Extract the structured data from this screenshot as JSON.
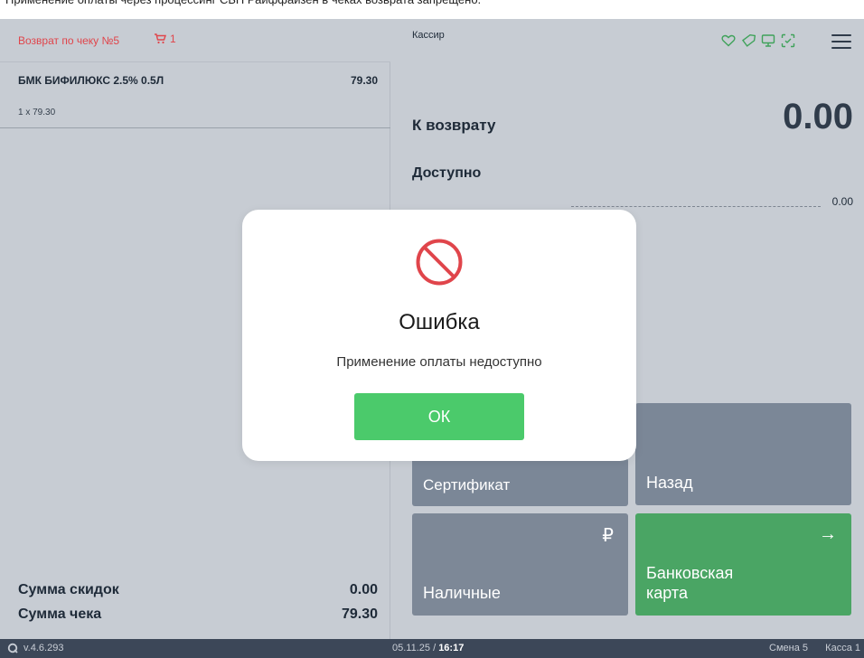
{
  "caption": "Применение оплаты через процессинг СБП Райффайзен в чеках возврата запрещено.",
  "left_panel": {
    "title": "Возврат по чеку №5",
    "cart_count": "1",
    "item": {
      "name": "БМК БИФИЛЮКС 2.5% 0.5Л",
      "price": "79.30",
      "qty": "1 x 79.30"
    },
    "totals": [
      {
        "label": "Сумма скидок",
        "value": "0.00"
      },
      {
        "label": "Сумма чека",
        "value": "79.30"
      }
    ]
  },
  "right_panel": {
    "cashier": "Кассир",
    "icons": [
      "heart-icon",
      "tag-icon",
      "monitor-icon",
      "scan-icon"
    ],
    "refund_label": "К возврату",
    "refund_value": "0.00",
    "available_label": "Доступно",
    "available_value": "0.00",
    "tiles": {
      "certificate": "Сертификат",
      "back": "Назад",
      "cash": "Наличные",
      "cash_icon": "₽",
      "card": "Банковская карта",
      "card_icon": "→"
    }
  },
  "status_bar": {
    "version": "v.4.6.293",
    "date": "05.11.25",
    "time": "16:17",
    "shift": "Смена 5",
    "register": "Касса 1"
  },
  "dialog": {
    "title": "Ошибка",
    "message": "Применение оплаты недоступно",
    "ok_label": "ОК"
  },
  "colors": {
    "accent_red": "#e0454b",
    "accent_green": "#4bca6b",
    "tile_gray": "#7b8797",
    "status_bg": "#3c4758"
  }
}
